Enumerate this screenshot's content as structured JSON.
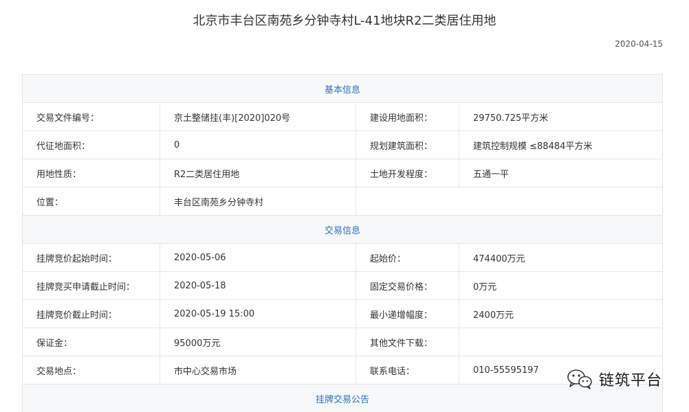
{
  "header": {
    "title": "北京市丰台区南苑乡分钟寺村L-41地块R2二类居住用地",
    "date": "2020-04-15"
  },
  "sections": {
    "basic": {
      "title": "基本信息",
      "rows": [
        {
          "l1": "交易文件编号：",
          "v1": "京土整储挂(丰)[2020]020号",
          "l2": "建设用地面积：",
          "v2": "29750.725平方米"
        },
        {
          "l1": "代征地面积：",
          "v1": "0",
          "l2": "规划建筑面积：",
          "v2": "建筑控制规模 ≤88484平方米"
        },
        {
          "l1": "用地性质：",
          "v1": "R2二类居住用地",
          "l2": "土地开发程度：",
          "v2": "五通一平"
        },
        {
          "l1": "位置：",
          "v1": "丰台区南苑乡分钟寺村",
          "l2": "",
          "v2": ""
        }
      ]
    },
    "trade": {
      "title": "交易信息",
      "rows": [
        {
          "l1": "挂牌竞价起始时间：",
          "v1": "2020-05-06",
          "l2": "起始价：",
          "v2": "474400万元"
        },
        {
          "l1": "挂牌竞买申请截止时间：",
          "v1": "2020-05-18",
          "l2": "固定交易价格：",
          "v2": "0万元"
        },
        {
          "l1": "挂牌竞价截止时间：",
          "v1": "2020-05-19 15:00",
          "l2": "最小递增幅度：",
          "v2": "2400万元"
        },
        {
          "l1": "保证金：",
          "v1": "95000万元",
          "l2": "其他文件下载：",
          "v2": ""
        },
        {
          "l1": "交易地点：",
          "v1": "市中心交易市场",
          "l2": "联系电话：",
          "v2": "010-55595197"
        }
      ]
    },
    "notice": {
      "title": "挂牌交易公告"
    }
  },
  "watermark": {
    "icon": "wechat-icon",
    "text": "链筑平台"
  }
}
